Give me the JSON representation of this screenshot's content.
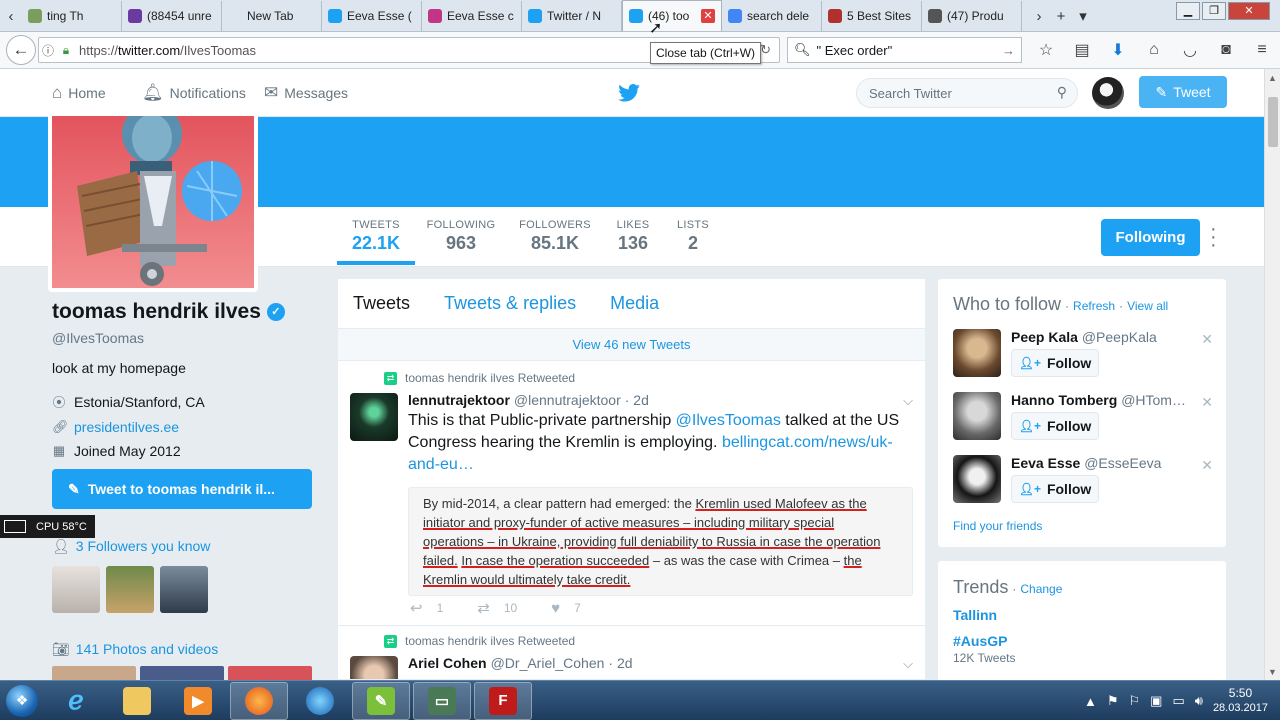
{
  "browser": {
    "tabs": [
      {
        "label": "ting Th",
        "color": "#7a9e5c",
        "active": false
      },
      {
        "label": "(88454 unre",
        "color": "#6a3aa0",
        "active": false
      },
      {
        "label": "New Tab",
        "color": "",
        "active": false
      },
      {
        "label": "Eeva Esse (",
        "color": "#1da1f2",
        "active": false
      },
      {
        "label": "Eeva Esse c",
        "color": "#c13584",
        "active": false
      },
      {
        "label": "Twitter / N",
        "color": "#1da1f2",
        "active": false
      },
      {
        "label": "(46) too",
        "color": "#1da1f2",
        "active": true
      },
      {
        "label": "search dele",
        "color": "#4285f4",
        "active": false
      },
      {
        "label": "5 Best Sites",
        "color": "#b03030",
        "active": false
      },
      {
        "label": "(47) Produ",
        "color": "#555555",
        "active": false
      }
    ],
    "close_glyph": "✕",
    "tab_tooltip": "Close tab (Ctrl+W)",
    "url_prefix": "https://",
    "url_domain": "twitter.com",
    "url_path": "/IlvesToomas",
    "search_value": "\" Exec order\"",
    "controls": {
      "min": "▁",
      "max": "❐",
      "close": "✕",
      "new_tab": "+",
      "list": "▾",
      "scroll_left": "‹",
      "scroll_right": "›"
    }
  },
  "twitter_nav": {
    "home": "Home",
    "notifications": "Notifications",
    "messages": "Messages",
    "search_placeholder": "Search Twitter",
    "tweet_button": "Tweet"
  },
  "profile": {
    "name": "toomas hendrik ilves",
    "handle": "@IlvesToomas",
    "bio": "look at my homepage",
    "location": "Estonia/Stanford, CA",
    "website": "presidentilves.ee",
    "joined": "Joined May 2012",
    "tweet_to": "Tweet to toomas hendrik il...",
    "followers_you_know": "3 Followers you know",
    "photos": "141 Photos and videos",
    "following_button": "Following"
  },
  "stats": [
    {
      "label": "TWEETS",
      "value": "22.1K",
      "active": true
    },
    {
      "label": "FOLLOWING",
      "value": "963",
      "active": false
    },
    {
      "label": "FOLLOWERS",
      "value": "85.1K",
      "active": false
    },
    {
      "label": "LIKES",
      "value": "136",
      "active": false
    },
    {
      "label": "LISTS",
      "value": "2",
      "active": false
    }
  ],
  "cpu": "CPU 58°C",
  "timeline": {
    "tabs": [
      "Tweets",
      "Tweets & replies",
      "Media"
    ],
    "new_tweets": "View 46 new Tweets",
    "tweet1": {
      "retweeted_by": "toomas hendrik ilves Retweeted",
      "name": "lennutrajektoor",
      "handle": "@lennutrajektoor",
      "time": "· 2d",
      "text_a": "This is that Public-private partnership ",
      "mention": "@IlvesToomas",
      "text_b": " talked at the US Congress hearing the Kremlin is employing. ",
      "link": "bellingcat.com/news/uk-and-eu…",
      "quote_1": "By mid-2014, a clear pattern had emerged: the ",
      "quote_u1": "Kremlin used Malofeev as the initiator and proxy-funder of active measures – including military special operations – in Ukraine,  providing full deniability to Russia in case the operation failed.",
      "quote_2": " ",
      "quote_u2": "In case the operation succeeded",
      "quote_3": " – as was the case with Crimea – ",
      "quote_u3": "the Kremlin would ultimately take credit.",
      "replies": "1",
      "retweets": "10",
      "likes": "7"
    },
    "tweet2": {
      "retweeted_by": "toomas hendrik ilves Retweeted",
      "name": "Ariel Cohen",
      "handle": "@Dr_Ariel_Cohen",
      "time": "· 2d"
    }
  },
  "who_to_follow": {
    "title": "Who to follow",
    "refresh": "Refresh",
    "view_all": "View all",
    "follow_label": "Follow",
    "suggestions": [
      {
        "name": "Peep Kala",
        "handle": "@PeepKala"
      },
      {
        "name": "Hanno Tomberg",
        "handle": "@HTom…"
      },
      {
        "name": "Eeva Esse",
        "handle": "@EsseEeva"
      }
    ],
    "find_friends": "Find your friends"
  },
  "trends": {
    "title": "Trends",
    "change": "Change",
    "items": [
      {
        "name": "Tallinn",
        "count": ""
      },
      {
        "name": "#AusGP",
        "count": "12K Tweets"
      }
    ]
  },
  "taskbar": {
    "time": "5:50",
    "date": "28.03.2017"
  },
  "colors": {
    "twitter_blue": "#1da1f2",
    "link_blue": "#1b95e0",
    "retweet_green": "#19cf86"
  }
}
